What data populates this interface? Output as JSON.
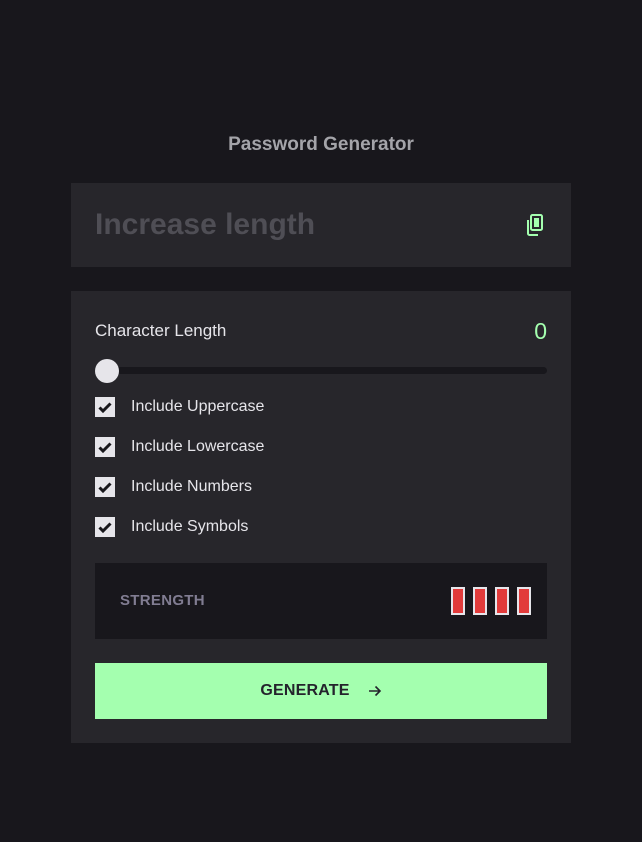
{
  "app": {
    "title": "Password Generator"
  },
  "output": {
    "text": "Increase length",
    "copy_icon": "copy-icon"
  },
  "length": {
    "label": "Character Length",
    "value": "0",
    "slider_fraction": 0
  },
  "options": [
    {
      "label": "Include Uppercase",
      "checked": true
    },
    {
      "label": "Include Lowercase",
      "checked": true
    },
    {
      "label": "Include Numbers",
      "checked": true
    },
    {
      "label": "Include Symbols",
      "checked": true
    }
  ],
  "strength": {
    "label": "STRENGTH",
    "bars_filled": 4,
    "bar_color": "#e23b3b"
  },
  "generate": {
    "label": "GENERATE",
    "icon": "arrow-right-icon"
  },
  "colors": {
    "accent": "#a4ffaf",
    "background": "#18171c",
    "panel": "#27262b"
  }
}
